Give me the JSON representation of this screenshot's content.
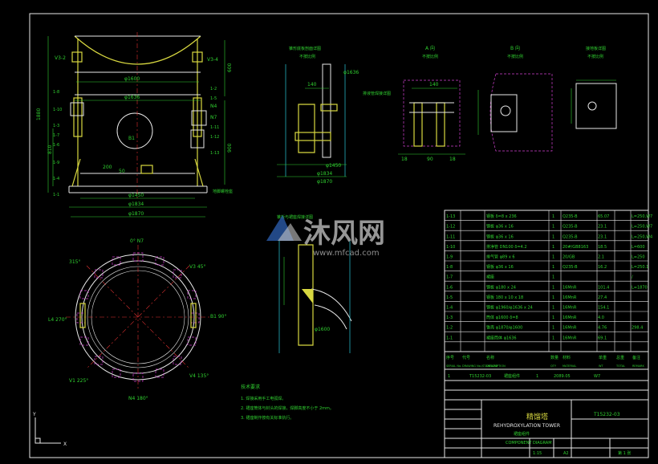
{
  "views": {
    "A": "A 向",
    "B": "B 向",
    "C": "接地板详图",
    "scale_note": "不按比例",
    "gasket": "锥形底板剖面详图",
    "weld_detail": "锥板与裙座焊接详图",
    "nozzle_detail": "排液管焊接详图",
    "anchor": "地脚螺栓座"
  },
  "dims": {
    "d1600": "φ1600",
    "d1636": "φ1636",
    "d1450": "φ1450",
    "d1834": "φ1834",
    "d1870": "φ1870",
    "h1880": "1880",
    "h600": "600",
    "h900": "900",
    "h810": "810",
    "h160": "160",
    "h250": "250",
    "w140": "140",
    "w90": "90",
    "w18": "18",
    "w200": "200",
    "w50": "50"
  },
  "nozzles": [
    "V3-2",
    "V3-4",
    "1-8",
    "1-10",
    "1-3",
    "1-7",
    "1-6",
    "1-9",
    "1-4",
    "1-1",
    "1-2",
    "1-5",
    "1-11",
    "1-12",
    "1-13",
    "N4",
    "N7",
    "B1"
  ],
  "plan": {
    "n7": "0°  N7",
    "v3": "V3 45°",
    "b1": "B1 90°",
    "v4": "V4 135°",
    "n4": "N4 180°",
    "v1": "V1 225°",
    "l4": "L4 270°",
    "v2": "315°"
  },
  "watermark": {
    "cn": "沐风网",
    "url": "www.mfcad.com"
  },
  "notes": {
    "title": "技术要求",
    "items": [
      "1. 焊接采用手工电弧焊。",
      "2. 裙座筒体与封头的焊接，焊脚高度不小于 2mm。",
      "3. 裙座制作按有关标准执行。"
    ]
  },
  "bom": {
    "rows": [
      {
        "no": "1-13",
        "name": "钢板 δ=8 x 236",
        "qty": "1",
        "mat": "Q235-B",
        "wt": "65.07",
        "note": "L=250,W7"
      },
      {
        "no": "1-12",
        "name": "钢板 φ36 x 16",
        "qty": "1",
        "mat": "Q235-B",
        "wt": "23.1",
        "note": "L=250,W7"
      },
      {
        "no": "1-11",
        "name": "钢板 φ36 x 16",
        "qty": "1",
        "mat": "Q235-B",
        "wt": "23.1",
        "note": "L=250,W4"
      },
      {
        "no": "1-10",
        "name": "排净管 DN100 δ=4.2",
        "qty": "1",
        "mat": "20#/GB8163",
        "wt": "18.5",
        "note": "L=600"
      },
      {
        "no": "1-9",
        "name": "排气管 φ89 x 6",
        "qty": "1",
        "mat": "20/GB",
        "wt": "2.1",
        "note": "L=250"
      },
      {
        "no": "1-8",
        "name": "钢板 φ36 x 16",
        "qty": "1",
        "mat": "Q235-B",
        "wt": "16.2",
        "note": "L=250.1"
      },
      {
        "no": "1-7",
        "name": "裙座",
        "qty": "1",
        "mat": "",
        "wt": "",
        "note": "/"
      },
      {
        "no": "1-6",
        "name": "钢板 φ180 x 24",
        "qty": "1",
        "mat": "16MnR",
        "wt": "101.4",
        "note": "L=1870"
      },
      {
        "no": "1-5",
        "name": "钢板 180 x 10 x 18",
        "qty": "1",
        "mat": "16MnR",
        "wt": "27.4",
        "note": ""
      },
      {
        "no": "1-4",
        "name": "钢板 φ1960/φ1636 x 24",
        "qty": "1",
        "mat": "16MnR",
        "wt": "154.1",
        "note": ""
      },
      {
        "no": "1-3",
        "name": "筒体 φ1600 δ=8",
        "qty": "1",
        "mat": "16MnR",
        "wt": "4.0",
        "note": ""
      },
      {
        "no": "1-2",
        "name": "锥壳 φ1870/φ1600",
        "qty": "1",
        "mat": "16MnR",
        "wt": "4.76",
        "note": "298.4"
      },
      {
        "no": "1-1",
        "name": "裙座筒体 φ1636",
        "qty": "1",
        "mat": "16MnR",
        "wt": "69.1",
        "note": ""
      }
    ],
    "header": [
      "序号",
      "代号",
      "名称",
      "数量",
      "材料",
      "单重",
      "总重",
      "备注"
    ],
    "header_en": [
      "SERIAL No.",
      "DRAWING No./STANDARD",
      "DESCRIPTION",
      "QTY",
      "MATERIAL",
      "WT",
      "TOTAL",
      "REMARK"
    ],
    "assy": {
      "no": "1",
      "dwg": "T15232-03",
      "name": "裙座组件",
      "qty": "1",
      "wt": "2089.05",
      "total": "W7"
    }
  },
  "title_block": {
    "cn_title": "精馏塔",
    "en_title": "REHYDROXYLATION TOWER",
    "sub": "裙座组件",
    "sub_en": "COMPONENT DIAGRAM",
    "dwg_no": "T15232-03",
    "scale": "1:15",
    "size": "A2",
    "sheet": "第 1 张",
    "rev": "0"
  },
  "ucs": {
    "x": "X",
    "y": "Y"
  }
}
